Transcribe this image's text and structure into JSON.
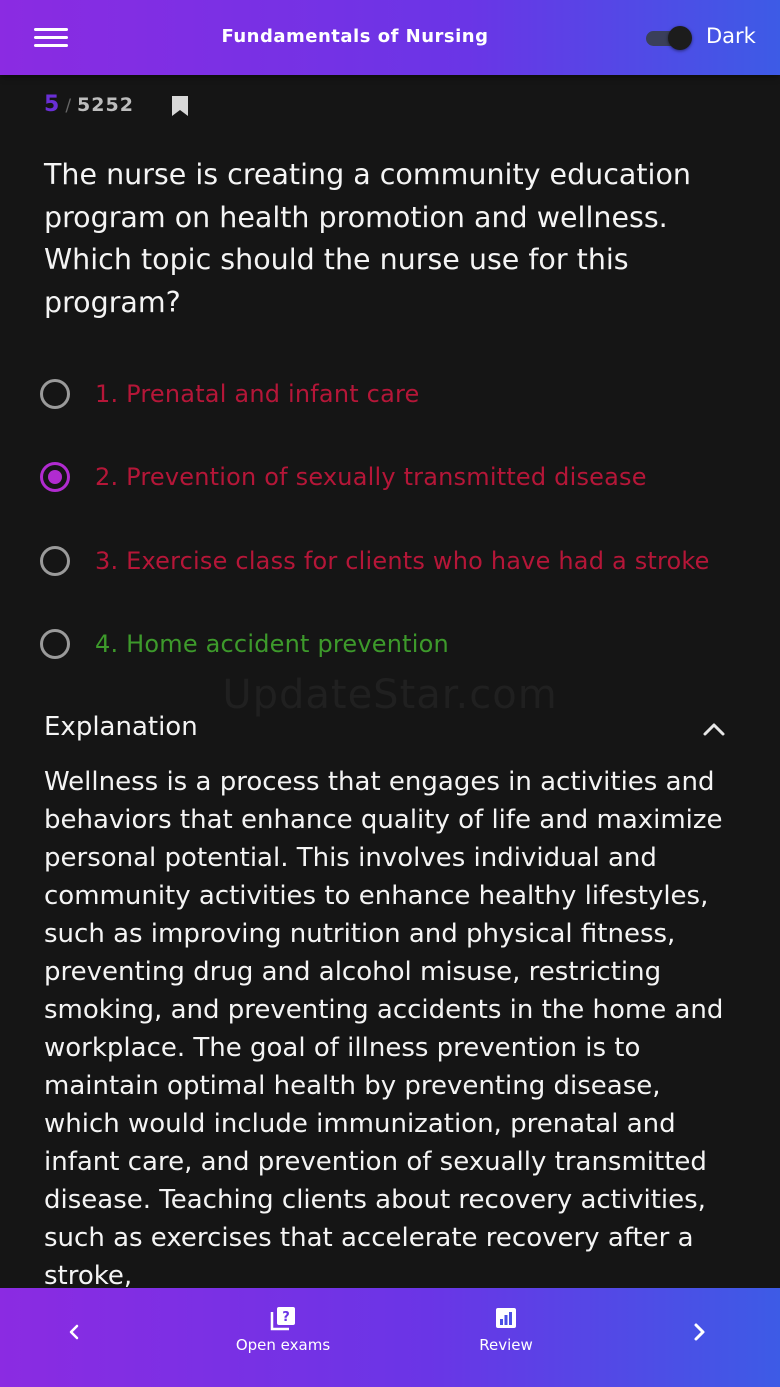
{
  "header": {
    "title": "Fundamentals of Nursing",
    "theme_label": "Dark",
    "theme_toggle_on": true
  },
  "counter": {
    "current": "5",
    "separator": "/",
    "total": "5252"
  },
  "question": {
    "text": "The nurse is creating a community education program on health promotion and wellness. Which topic should the nurse use for this program?",
    "options": [
      {
        "label": "1. Prenatal and infant care",
        "state": "incorrect",
        "selected": false
      },
      {
        "label": "2. Prevention of sexually transmitted disease",
        "state": "incorrect",
        "selected": true
      },
      {
        "label": "3. Exercise class for clients who have had a stroke",
        "state": "incorrect",
        "selected": false
      },
      {
        "label": "4. Home accident prevention",
        "state": "correct",
        "selected": false
      }
    ]
  },
  "watermark": "UpdateStar.com",
  "explanation": {
    "title": "Explanation",
    "text": "Wellness is a process that engages in activities and behaviors that enhance quality of life and maximize personal potential. This involves individual and community activities to enhance healthy lifestyles, such as improving nutrition and physical fitness, preventing drug and alcohol misuse, restricting smoking, and preventing accidents in the home and workplace. The goal of illness prevention is to maintain optimal health by preventing disease, which would include immunization, prenatal and infant care, and prevention of sexually transmitted disease. Teaching clients about recovery activities, such as exercises that accelerate recovery after a stroke,"
  },
  "bottom_nav": {
    "open_exams_label": "Open exams",
    "review_label": "Review"
  },
  "colors": {
    "accent_gradient_start": "#8b2be2",
    "accent_gradient_end": "#3d5be6",
    "incorrect": "#b51638",
    "correct": "#3d9a2b",
    "selected_radio": "#b12bd0",
    "counter_current": "#6a2fd6"
  },
  "icons": {
    "menu": "hamburger-menu-icon",
    "bookmark": "bookmark-icon",
    "explanation_toggle": "chevron-up-icon",
    "prev": "chevron-left-icon",
    "next": "chevron-right-icon",
    "open_exams": "question-stack-icon",
    "review": "chart-icon"
  }
}
